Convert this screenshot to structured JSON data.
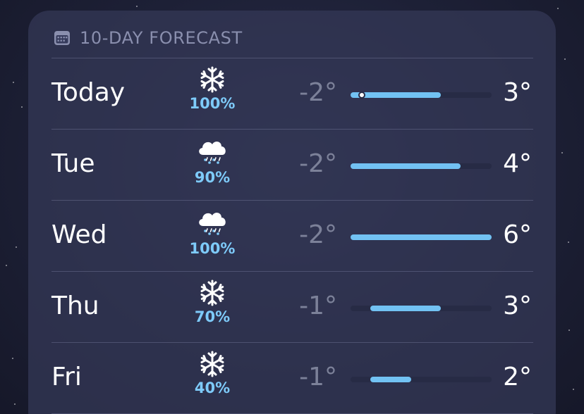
{
  "widget": {
    "title": "10-DAY FORECAST",
    "icon": "calendar-icon"
  },
  "colors": {
    "accent_blue": "#7ecbfa",
    "bar_fill": "#72c2f3",
    "low_temp_gray": "#7c8199"
  },
  "forecast": [
    {
      "day": "Today",
      "icon": "snowflake-icon",
      "precip": "100%",
      "low": "-2°",
      "high": "3°",
      "range_start_pct": 0,
      "range_end_pct": 64,
      "current_pct": 8
    },
    {
      "day": "Tue",
      "icon": "cloud-snow-icon",
      "precip": "90%",
      "low": "-2°",
      "high": "4°",
      "range_start_pct": 0,
      "range_end_pct": 78
    },
    {
      "day": "Wed",
      "icon": "cloud-snow-icon",
      "precip": "100%",
      "low": "-2°",
      "high": "6°",
      "range_start_pct": 0,
      "range_end_pct": 100
    },
    {
      "day": "Thu",
      "icon": "snowflake-icon",
      "precip": "70%",
      "low": "-1°",
      "high": "3°",
      "range_start_pct": 14,
      "range_end_pct": 64
    },
    {
      "day": "Fri",
      "icon": "snowflake-icon",
      "precip": "40%",
      "low": "-1°",
      "high": "2°",
      "range_start_pct": 14,
      "range_end_pct": 43
    }
  ]
}
